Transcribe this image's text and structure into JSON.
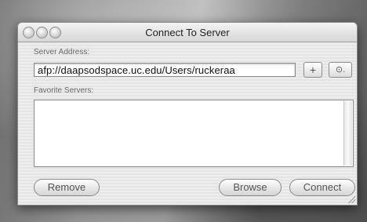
{
  "window": {
    "title": "Connect To Server"
  },
  "server_address": {
    "label": "Server Address:",
    "value": "afp://daapsodspace.uc.edu/Users/ruckeraa",
    "add_button": "+",
    "recent_button": "⊙."
  },
  "favorites": {
    "label": "Favorite Servers:",
    "items": []
  },
  "buttons": {
    "remove": "Remove",
    "browse": "Browse",
    "connect": "Connect"
  }
}
